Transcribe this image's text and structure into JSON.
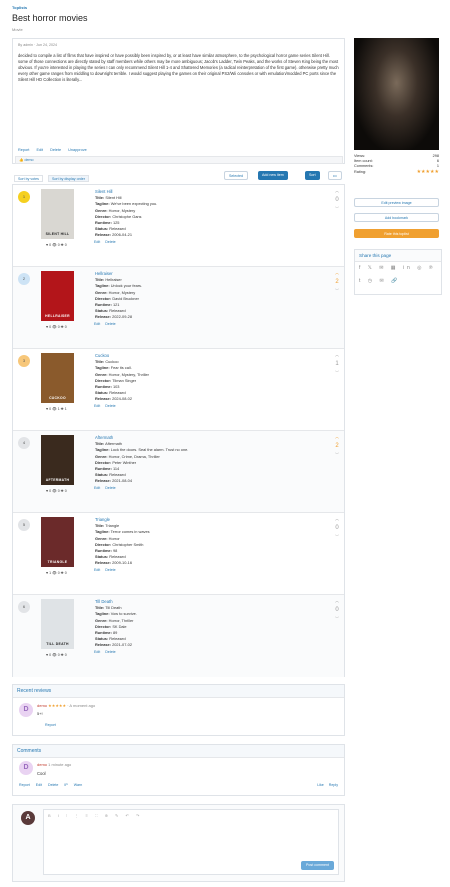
{
  "breadcrumb": "Toplists",
  "title": "Best horror movies",
  "subtitle": "Movie",
  "author_line": "By admin · Jun 24, 2024",
  "description": "decided to compile a list of films that have inspired or have possibly been inspired by, or at least have similar atmosphere, to the psychological horror game series Silent Hill. some of those connections are directly stated by staff members while others may be more ambiguous; Jacob's Ladder, Twin Peaks, and the works of Steven King being the most obvious. If you're interested in playing the series I can only recommend Silent Hill 1-4 and Shattered Memories (a radical reinterpretation of the first game). otherwise pretty much every other game ranges from middling to downright terrible. I would suggest playing the games on their original PS2/Wii consoles or with emulation/modded PC ports since the Silent Hill HD Collection is literally...",
  "actions": [
    "Report",
    "Edit",
    "Delete",
    "Unapprove"
  ],
  "like_label": "demo",
  "sort": {
    "votes": "Sort by votes",
    "display": "Sort by display order"
  },
  "buttons": {
    "selected": "Selected",
    "add": "Add new item",
    "sort": "Sort",
    "more": "•••"
  },
  "items": [
    {
      "rank": "1",
      "name": "Silent Hill",
      "title": "Silent Hill",
      "tagline": "We've been expecting you.",
      "genre": "Horror, Mystery",
      "director": "Christophe Gans",
      "runtime": "125",
      "status": "Released",
      "release": "2006-04-21",
      "stats": "♥ 0  👁 0  ✚ 0",
      "votes": "0",
      "caption": "SILENT HILL",
      "bg": "#d9d7d2",
      "cap_color": "#222"
    },
    {
      "rank": "2",
      "name": "Hellraiser",
      "title": "Hellraiser",
      "tagline": "Unlock your fears.",
      "genre": "Horror, Mystery",
      "director": "David Bruckner",
      "runtime": "121",
      "status": "Released",
      "release": "2022-09-28",
      "stats": "♥ 0  👁 0  ✚ 0",
      "votes": "2",
      "caption": "HELLRAISER",
      "bg": "#b3151a",
      "cap_color": "#fff"
    },
    {
      "rank": "3",
      "name": "Cuckoo",
      "title": "Cuckoo",
      "tagline": "Fear its call.",
      "genre": "Horror, Mystery, Thriller",
      "director": "Tilman Singer",
      "runtime": "103",
      "status": "Released",
      "release": "2024-08-02",
      "stats": "♥ 0  👁 1  ✚ 1",
      "votes": "1",
      "caption": "CUCKOO",
      "bg": "#8a5a2c",
      "cap_color": "#fff"
    },
    {
      "rank": "4",
      "name": "Aftermath",
      "title": "Aftermath",
      "tagline": "Lock the doors. Seal the alarm. Trust no one.",
      "genre": "Horror, Crime, Drama, Thriller",
      "director": "Peter Winther",
      "runtime": "114",
      "status": "Released",
      "release": "2021-08-04",
      "stats": "♥ 0  👁 0  ✚ 0",
      "votes": "2",
      "caption": "AFTERMATH",
      "bg": "#3a2a1e",
      "cap_color": "#ddd"
    },
    {
      "rank": "5",
      "name": "Triangle",
      "title": "Triangle",
      "tagline": "Terror comes in waves",
      "genre": "Horror",
      "director": "Christopher Smith",
      "runtime": "98",
      "status": "Released",
      "release": "2009-10-16",
      "stats": "♥ 1  👁 0  ✚ 0",
      "votes": "0",
      "caption": "TRIANGLE",
      "bg": "#6b2a2a",
      "cap_color": "#fff"
    },
    {
      "rank": "6",
      "name": "Till Death",
      "title": "Till Death",
      "tagline": "Vow to survive.",
      "genre": "Horror, Thriller",
      "director": "SK Dale",
      "runtime": "89",
      "status": "Released",
      "release": "2021-07-02",
      "stats": "♥ 0  👁 0  ✚ 0",
      "votes": "0",
      "caption": "TILL DEATH",
      "bg": "#dfe3e6",
      "cap_color": "#222"
    }
  ],
  "row_actions": {
    "edit": "Edit",
    "delete": "Delete"
  },
  "labels": {
    "title": "Title:",
    "tagline": "Tagline:",
    "genre": "Genre:",
    "director": "Director:",
    "runtime": "Runtime:",
    "status": "Status:",
    "release": "Release:"
  },
  "side": {
    "views_label": "Views:",
    "views": "298",
    "items_label": "Item count:",
    "items": "6",
    "comments_label": "Comments:",
    "comments": "1",
    "rating_label": "Rating:",
    "rating": "★★★★★",
    "edit_image": "Edit preview image",
    "bookmark": "Add bookmark",
    "rate": "Rate this toplist"
  },
  "share": {
    "title": "Share this page",
    "icons1": "f 𝕏 ✉ ▦ in ◎ ℗",
    "icons2": "t ◷ ✉ 🔗"
  },
  "reviews": {
    "title": "Recent reviews",
    "user": "demo",
    "stars": "★★★★★",
    "time": "· A moment ago",
    "text": "5+!",
    "report": "Report"
  },
  "comments": {
    "title": "Comments",
    "user": "demo",
    "time": "1 minute ago",
    "text": "Cool",
    "report": "Report",
    "edit": "Edit",
    "delete": "Delete",
    "ip": "IP",
    "warn": "Warn",
    "like": "Like",
    "reply": "Reply"
  },
  "editor": {
    "toolbar": "B I ⁝ ⋮ ≡ ∷ ⊕ ✎ ↶ ↷",
    "post": "Post comment",
    "avatar": "A"
  }
}
